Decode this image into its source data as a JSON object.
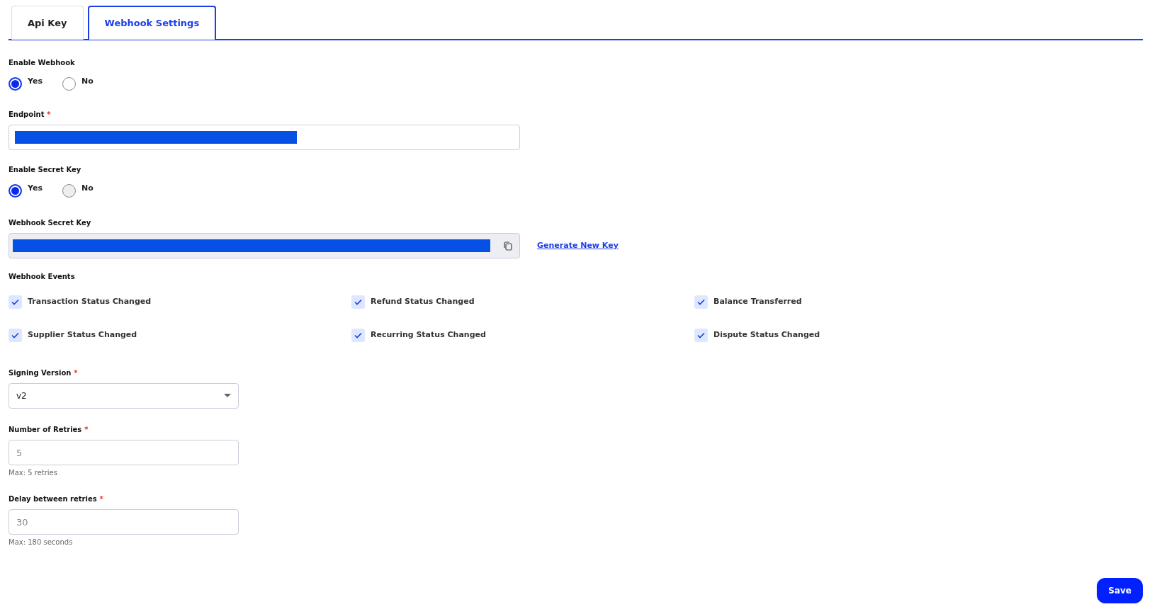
{
  "tabs": [
    {
      "label": "Api Key",
      "selected": false
    },
    {
      "label": "Webhook Settings",
      "selected": true
    }
  ],
  "enable_webhook": {
    "label": "Enable Webhook",
    "options": [
      {
        "label": "Yes",
        "selected": true,
        "disabled": false
      },
      {
        "label": "No",
        "selected": false,
        "disabled": false
      }
    ]
  },
  "endpoint": {
    "label": "Endpoint",
    "required_mark": "*",
    "redacted": true
  },
  "enable_secret_key": {
    "label": "Enable Secret Key",
    "options": [
      {
        "label": "Yes",
        "selected": true,
        "disabled": false
      },
      {
        "label": "No",
        "selected": false,
        "disabled": true
      }
    ]
  },
  "secret_key": {
    "label": "Webhook Secret Key",
    "redacted": true,
    "readonly": true,
    "link": "Generate New Key"
  },
  "webhook_events": {
    "label": "Webhook Events",
    "items": [
      {
        "label": "Transaction Status Changed",
        "checked": true
      },
      {
        "label": "Refund Status Changed",
        "checked": true
      },
      {
        "label": "Balance Transferred",
        "checked": true
      },
      {
        "label": "Supplier Status Changed",
        "checked": true
      },
      {
        "label": "Recurring Status Changed",
        "checked": true
      },
      {
        "label": "Dispute Status Changed",
        "checked": true
      }
    ]
  },
  "signing_version": {
    "label": "Signing Version",
    "required_mark": "*",
    "value": "v2"
  },
  "retries": {
    "label": "Number of Retries",
    "required_mark": "*",
    "placeholder": "5",
    "help": "Max: 5 retries"
  },
  "delay": {
    "label": "Delay between retries",
    "required_mark": "*",
    "placeholder": "30",
    "help": "Max: 180 seconds"
  },
  "save_button": "Save"
}
